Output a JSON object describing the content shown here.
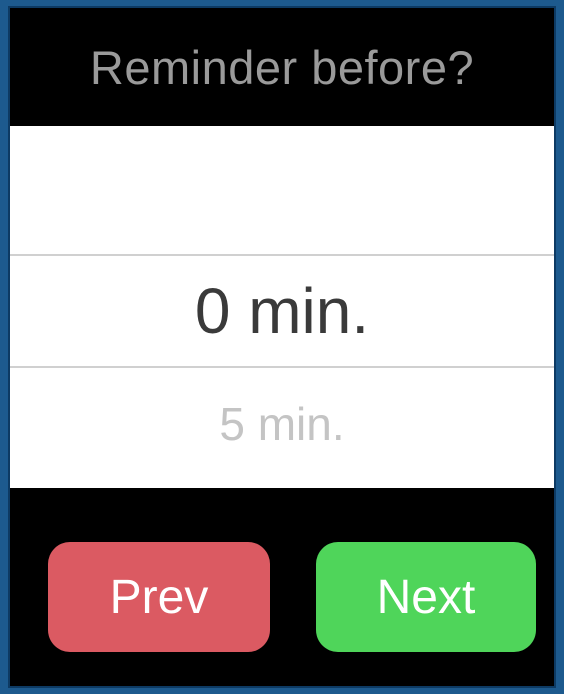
{
  "header": {
    "title": "Reminder before?"
  },
  "picker": {
    "options_visible": [
      "0 min.",
      "5 min."
    ],
    "selected": "0 min.",
    "next_option": "5 min."
  },
  "buttons": {
    "prev_label": "Prev",
    "next_label": "Next"
  },
  "colors": {
    "prev": "#db5a62",
    "next": "#4fd55a",
    "background": "#000000",
    "picker_bg": "#ffffff"
  }
}
